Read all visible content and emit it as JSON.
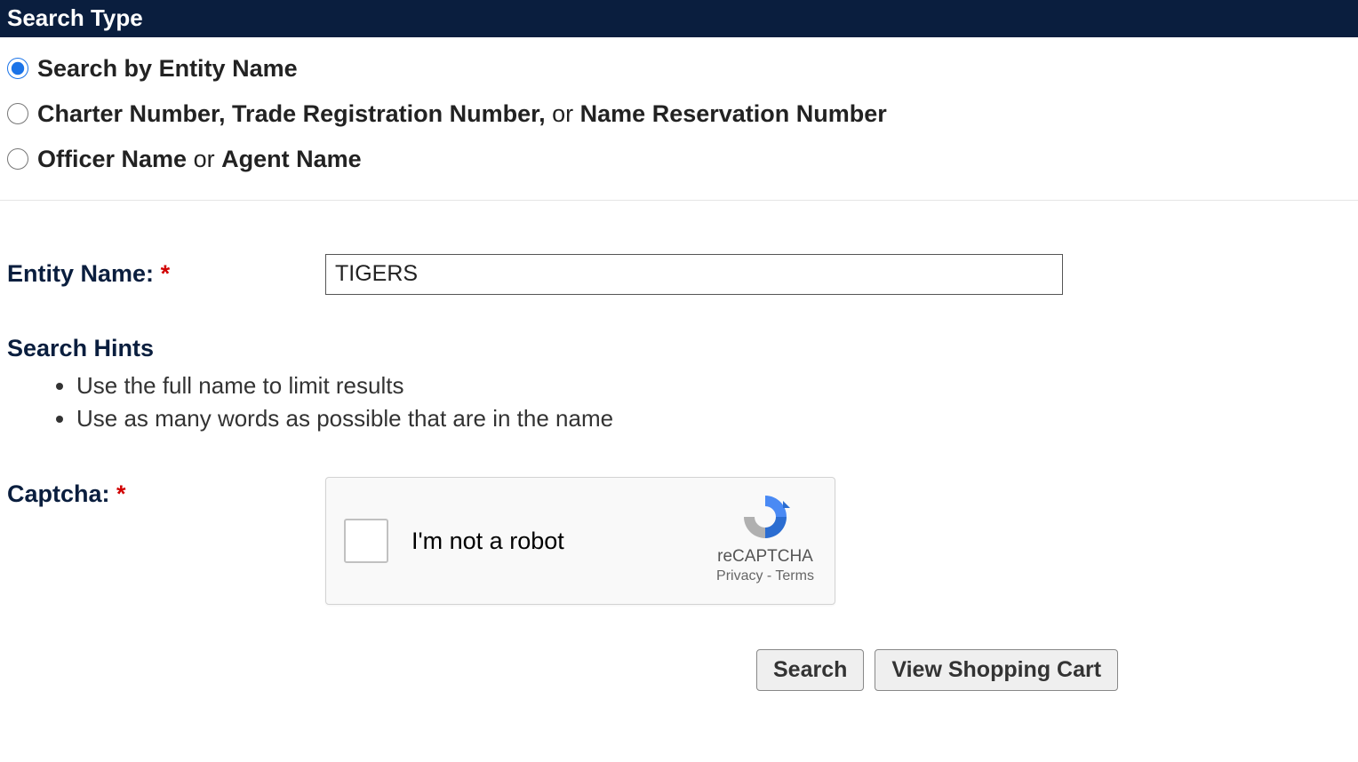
{
  "header": {
    "title": "Search Type"
  },
  "searchTypes": {
    "entity": {
      "label_b": "Search by Entity Name"
    },
    "number": {
      "label_b1": "Charter Number, Trade Registration Number,",
      "label_or": " or ",
      "label_b2": "Name Reservation Number"
    },
    "officer": {
      "label_b1": "Officer Name",
      "label_or": " or ",
      "label_b2": "Agent Name"
    }
  },
  "entityName": {
    "label": "Entity Name:",
    "value": "TIGERS"
  },
  "hints": {
    "title": "Search Hints",
    "items": [
      "Use the full name to limit results",
      "Use as many words as possible that are in the name"
    ]
  },
  "captcha": {
    "label": "Captcha:",
    "checkbox_text": "I'm not a robot",
    "brand": "reCAPTCHA",
    "privacy": "Privacy",
    "dash": " - ",
    "terms": "Terms"
  },
  "buttons": {
    "search": "Search",
    "cart": "View Shopping Cart"
  }
}
